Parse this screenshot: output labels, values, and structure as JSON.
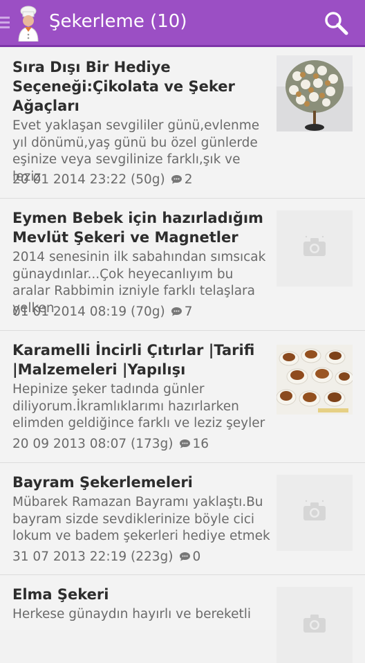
{
  "appbar": {
    "title": "Şekerleme (10)",
    "menu_icon": "menu-icon",
    "logo_icon": "chef-icon",
    "search_icon": "search-icon",
    "bg_color": "#9b4fc4"
  },
  "items": [
    {
      "title": "Sıra Dışı Bir Hediye Seçeneği:Çikolata ve Şeker Ağaçları",
      "excerpt": "  Evet yaklaşan sevgililer günü,evlenme yıl dönümü,yaş günü bu özel günlerde eşinize veya sevgilinize farklı,şık ve leziz",
      "date": "20 01 2014 23:22 (50g)",
      "comments": "2",
      "thumbnail": "photo-chocolate-tree"
    },
    {
      "title": "Eymen Bebek için hazırladığım Mevlüt Şekeri ve Magnetler",
      "excerpt": "2014 senesinin ilk sabahından sımsıcak günaydınlar...Çok heyecanlıyım bu aralar Rabbimin izniyle farklı telaşlara yelken",
      "date": "01 01 2014 08:19 (70g)",
      "comments": "7",
      "thumbnail": "camera-placeholder"
    },
    {
      "title": "Karamelli İncirli Çıtırlar |Tarifi |Malzemeleri |Yapılışı",
      "excerpt": "Hepinize şeker tadında günler diliyorum.İkramlıklarımı hazırlarken elimden geldiğince farklı ve leziz şeyler",
      "date": "20 09 2013 08:07 (173g)",
      "comments": "16",
      "thumbnail": "photo-fig-crisps"
    },
    {
      "title": "Bayram Şekerlemeleri",
      "excerpt": "Mübarek Ramazan Bayramı yaklaştı.Bu bayram sizde sevdiklerinize böyle cici lokum ve badem şekerleri hediye etmek",
      "date": "31 07 2013 22:19 (223g)",
      "comments": "0",
      "thumbnail": "camera-placeholder"
    },
    {
      "title": "Elma Şekeri",
      "excerpt": "Herkese günaydın hayırlı ve bereketli",
      "date": "",
      "comments": "",
      "thumbnail": "camera-placeholder"
    }
  ]
}
